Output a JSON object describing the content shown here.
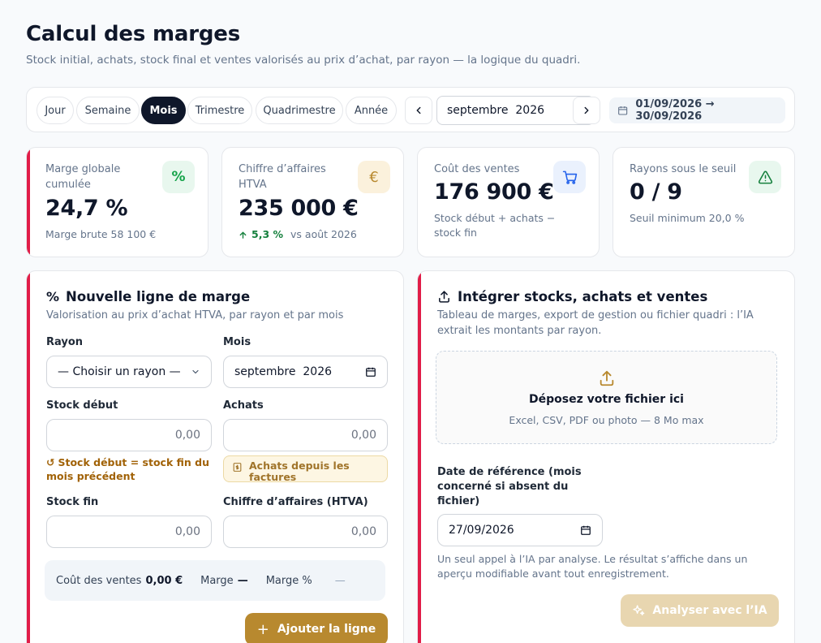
{
  "header": {
    "title": "Calcul des marges",
    "subtitle": "Stock initial, achats, stock final et ventes valorisés au prix d’achat, par rayon — la logique du quadri."
  },
  "period": {
    "tabs": [
      "Jour",
      "Semaine",
      "Mois",
      "Trimestre",
      "Quadrimestre",
      "Année"
    ],
    "active": "Mois",
    "month_value": "septembre  2026",
    "range_label": "01/09/2026 → 30/09/2026"
  },
  "kpis": {
    "margin": {
      "label": "Marge globale cumulée",
      "value": "24,7 %",
      "sub": "Marge brute 58 100 €",
      "icon_glyph": "%"
    },
    "revenue": {
      "label": "Chiffre d’affaires HTVA",
      "value": "235 000 €",
      "delta": "5,3 %",
      "delta_suffix": "vs août 2026",
      "icon_glyph": "€"
    },
    "cost": {
      "label": "Coût des ventes",
      "value": "176 900 €",
      "sub": "Stock début + achats − stock fin"
    },
    "below": {
      "label": "Rayons sous le seuil",
      "value": "0 / 9",
      "sub": "Seuil minimum 20,0 %"
    }
  },
  "form": {
    "title": "Nouvelle ligne de marge",
    "subtitle": "Valorisation au prix d’achat HTVA, par rayon et par mois",
    "title_icon": "%",
    "rayon_label": "Rayon",
    "rayon_value": "— Choisir un rayon —",
    "mois_label": "Mois",
    "mois_value": "septembre  2026",
    "stock_debut_label": "Stock début",
    "stock_debut_value": "0,00",
    "achats_label": "Achats",
    "achats_value": "0,00",
    "stock_hint_icon": "↺",
    "stock_hint": "Stock début = stock fin du mois précédent",
    "achats_hint": "Achats depuis les factures",
    "stock_fin_label": "Stock fin",
    "stock_fin_value": "0,00",
    "ca_label": "Chiffre d’affaires (HTVA)",
    "ca_value": "0,00",
    "summary": {
      "cost_label": "Coût des ventes",
      "cost_value": "0,00 €",
      "margin_label": "Marge",
      "margin_value": "—",
      "margin_pct_label": "Marge %",
      "margin_pct_value": "—"
    },
    "add_button_icon": "+",
    "add_button": "Ajouter la ligne"
  },
  "import": {
    "title": "Intégrer stocks, achats et ventes",
    "subtitle": "Tableau de marges, export de gestion ou fichier quadri : l’IA extrait les montants par rayon.",
    "drop_title": "Déposez votre fichier ici",
    "drop_sub": "Excel, CSV, PDF ou photo — 8 Mo max",
    "date_label": "Date de référence (mois concerné si absent du fichier)",
    "date_value": "27/09/2026",
    "note": "Un seul appel à l’IA par analyse. Le résultat s’affiche dans un aperçu modifiable avant tout enregistrement.",
    "analyze_button": "Analyser avec l’IA"
  },
  "colors": {
    "accent_red": "#e11d48",
    "gold": "#b8892f",
    "dark": "#0f172a",
    "success": "#15803d"
  }
}
